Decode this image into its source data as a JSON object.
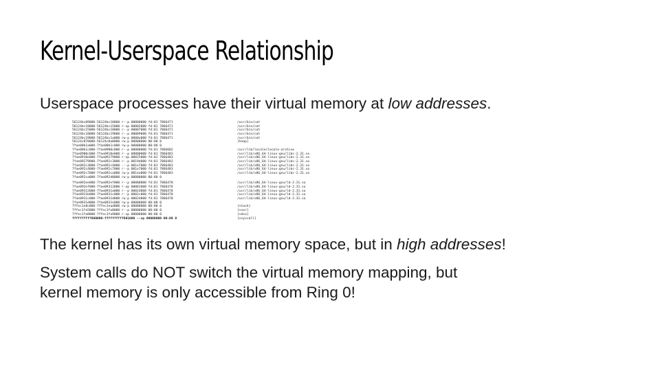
{
  "slide": {
    "title": "Kernel-Userspace Relationship",
    "p1": {
      "before": "Userspace processes have their virtual memory at ",
      "em": "low addresses",
      "after": "."
    },
    "p2": {
      "before": "The kernel has its own virtual memory space, but in ",
      "em": "high addresses",
      "after": "!"
    },
    "p3": {
      "line1": "System calls do NOT switch the virtual memory mapping, but",
      "line2": "kernel memory is only accessible from Ring 0!"
    }
  },
  "memory_map": [
    {
      "addr": "56124bc09000-56124bc10000 r--p 00000000 fd:01 7866471",
      "path": "/usr/bin/cat"
    },
    {
      "addr": "56124bc10000-56124bc15000 r-xp 00002000 fd:01 7866471",
      "path": "/usr/bin/cat"
    },
    {
      "addr": "56124bc15000-56124bc18000 r--p 00007000 fd:01 7866471",
      "path": "/usr/bin/cat"
    },
    {
      "addr": "56124bc18000-56124bc19000 r--p 00009000 fd:01 7866471",
      "path": "/usr/bin/cat"
    },
    {
      "addr": "56124bc19000-56124bc1a000 rw-p 0000a000 fd:01 7866471",
      "path": "/usr/bin/cat"
    },
    {
      "addr": "56124c078000-56124c0a0000 rw-p 00000000 00:00 0",
      "path": "[heap]"
    },
    {
      "addr": "7fae08b1a000-7fae08b1c000 rw-p 00000000 00:00 0",
      "path": ""
    },
    {
      "addr": "7fae08b1c000-7fae0900c000 r--p 00000000 fd:01 7866602",
      "path": "/usr/lib/locale/locale-archive"
    },
    {
      "addr": "7fae0900c000-7fae0910e000 r--p 00000000 fd:01 7866483",
      "path": "/usr/lib/x86_64-linux-gnu/libc-2.31.so"
    },
    {
      "addr": "7fae0910e000-7fae09279000 r-xp 00025000 fd:01 7866483",
      "path": "/usr/lib/x86_64-linux-gnu/libc-2.31.so"
    },
    {
      "addr": "7fae09279000-7fae092c3000 r--p 0019d000 fd:01 7866483",
      "path": "/usr/lib/x86_64-linux-gnu/libc-2.31.so"
    },
    {
      "addr": "7fae092c3000-7fae092c4000 ---p 001e7000 fd:01 7866483",
      "path": "/usr/lib/x86_64-linux-gnu/libc-2.31.so"
    },
    {
      "addr": "7fae092c4000-7fae092c7000 r--p 001e7000 fd:01 7866483",
      "path": "/usr/lib/x86_64-linux-gnu/libc-2.31.so"
    },
    {
      "addr": "7fae092c7000-7fae092ca000 rw-p 001ea000 fd:01 7866483",
      "path": "/usr/lib/x86_64-linux-gnu/libc-2.31.so"
    },
    {
      "addr": "7fae092ca000-7fae092d0000 rw-p 00000000 00:00 0",
      "path": ""
    },
    {
      "gap": true
    },
    {
      "addr": "7fae092ee000-7fae092ef000 r--p 00000000 fd:01 7866478",
      "path": "/usr/lib/x86_64-linux-gnu/ld-2.31.so"
    },
    {
      "addr": "7fae092ef000-7fae09312000 r-xp 00001000 fd:01 7866478",
      "path": "/usr/lib/x86_64-linux-gnu/ld-2.31.so"
    },
    {
      "addr": "7fae09312000-7fae0931a000 r--p 00024000 fd:01 7866478",
      "path": "/usr/lib/x86_64-linux-gnu/ld-2.31.so"
    },
    {
      "addr": "7fae0931b000-7fae0931c000 r--p 0002c000 fd:01 7866478",
      "path": "/usr/lib/x86_64-linux-gnu/ld-2.31.so"
    },
    {
      "addr": "7fae0931c000-7fae0931d000 rw-p 0002d000 fd:01 7866478",
      "path": "/usr/lib/x86_64-linux-gnu/ld-2.31.so"
    },
    {
      "addr": "7fae0931d000-7fae0931e000 rw-p 00000000 00:00 0",
      "path": ""
    },
    {
      "addr": "7ffec1e8c000-7ffec1ead000 rw-p 00000000 00:00 0",
      "path": "[stack]"
    },
    {
      "addr": "7ffec1fa5000-7ffec1fa8000 r--p 00000000 00:00 0",
      "path": "[vvar]"
    },
    {
      "addr": "7ffec1fa8000-7ffec1fa9000 r-xp 00000000 00:00 0",
      "path": "[vdso]"
    },
    {
      "addr": "ffffffffff600000-ffffffffff601000 --xp 00000000 00:00 0",
      "path": "[vsyscall]",
      "bold": true
    }
  ]
}
